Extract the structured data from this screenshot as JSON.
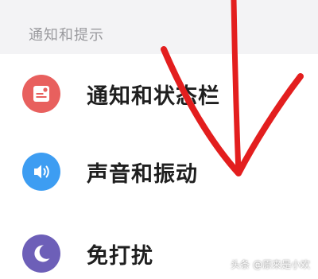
{
  "section": {
    "title": "通知和提示"
  },
  "items": [
    {
      "label": "通知和状态栏",
      "icon": "notification-icon",
      "icon_color": "#e8605e"
    },
    {
      "label": "声音和振动",
      "icon": "speaker-icon",
      "icon_color": "#3d9df2"
    },
    {
      "label": "免打扰",
      "icon": "moon-icon",
      "icon_color": "#6d5fb8"
    }
  ],
  "annotation": {
    "color": "#e31e1e",
    "shape": "red-hand-drawn-arrow-pointing-down"
  },
  "watermark": {
    "text": "头条 @原来是小欢"
  }
}
